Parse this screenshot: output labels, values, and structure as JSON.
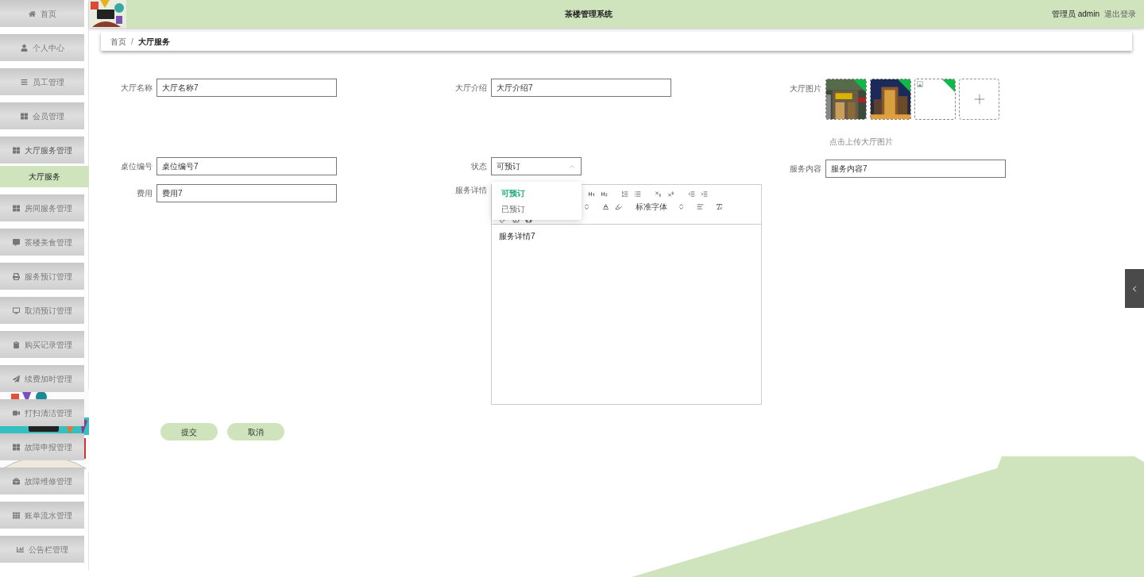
{
  "header": {
    "title": "茶楼管理系统",
    "user": "管理员 admin",
    "logout": "退出登录"
  },
  "sidebar": {
    "items": [
      {
        "label": "首页",
        "expanded": false
      },
      {
        "label": "个人中心",
        "expanded": false
      },
      {
        "label": "员工管理",
        "expanded": false
      },
      {
        "label": "会员管理",
        "expanded": false
      },
      {
        "label": "大厅服务管理",
        "expanded": true,
        "children": [
          {
            "label": "大厅服务",
            "selected": true
          }
        ]
      },
      {
        "label": "房间服务管理",
        "expanded": false
      },
      {
        "label": "茶楼美食管理",
        "expanded": false
      },
      {
        "label": "服务预订管理",
        "expanded": false
      },
      {
        "label": "取消预订管理",
        "expanded": false
      },
      {
        "label": "购买记录管理",
        "expanded": false
      },
      {
        "label": "续费加时管理",
        "expanded": false
      },
      {
        "label": "打扫清洁管理",
        "expanded": false
      },
      {
        "label": "故障申报管理",
        "expanded": false
      },
      {
        "label": "故障维修管理",
        "expanded": false
      },
      {
        "label": "账单流水管理",
        "expanded": false
      },
      {
        "label": "公告栏管理",
        "expanded": false
      }
    ]
  },
  "breadcrumb": {
    "items": [
      "首页",
      "大厅服务"
    ],
    "separator": "/"
  },
  "form": {
    "columns": [
      {
        "fields": [
          {
            "kind": "text",
            "label": "大厅名称",
            "value": "大厅名称7"
          },
          {
            "kind": "text",
            "label": "桌位编号",
            "value": "桌位编号7"
          },
          {
            "kind": "text",
            "label": "费用",
            "value": "费用7"
          }
        ]
      },
      {
        "fields": [
          {
            "kind": "text",
            "label": "大厅介绍",
            "value": "大厅介绍7"
          },
          {
            "kind": "select",
            "label": "状态",
            "value": "可预订",
            "expanded": true,
            "options": [
              {
                "label": "可预订",
                "selected": true
              },
              {
                "label": "已预订",
                "selected": false
              }
            ]
          },
          {
            "kind": "editor",
            "label": "服务详情",
            "font_select": "标准字体",
            "value": "服务详情7"
          }
        ]
      },
      {
        "fields": [
          {
            "kind": "images",
            "label": "大厅图片",
            "images": [
              {
                "kind": "picture"
              },
              {
                "kind": "picture"
              },
              {
                "kind": "broken"
              }
            ],
            "hint": "点击上传大厅图片"
          },
          {
            "kind": "text",
            "label": "服务内容",
            "value": "服务内容7"
          }
        ]
      }
    ],
    "buttons": [
      "提交",
      "取消"
    ]
  }
}
